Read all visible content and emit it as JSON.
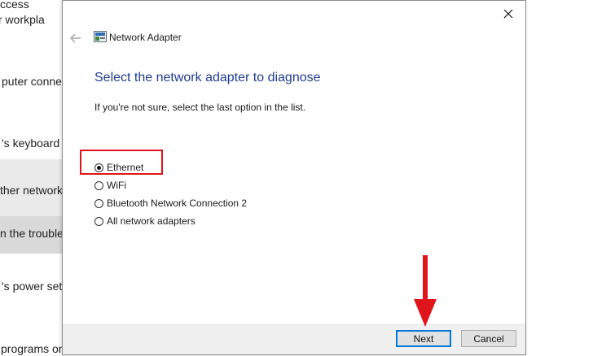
{
  "background": {
    "items": [
      "ccess",
      "r workpla",
      "puter conne",
      "'s keyboard",
      "ther network",
      "n the trouble",
      "'s power set",
      "programs on"
    ]
  },
  "dialog": {
    "app_title": "Network Adapter",
    "heading": "Select the network adapter to diagnose",
    "subtext": "If you're not sure, select the last option in the list.",
    "options": [
      {
        "label": "Ethernet",
        "checked": true
      },
      {
        "label": "WiFi",
        "checked": false
      },
      {
        "label": "Bluetooth Network Connection 2",
        "checked": false
      },
      {
        "label": "All network adapters",
        "checked": false
      }
    ],
    "buttons": {
      "next": "Next",
      "cancel": "Cancel"
    }
  },
  "icons": [
    "back-arrow-icon",
    "network-adapter-icon",
    "close-icon",
    "annotation-arrow-icon"
  ],
  "colors": {
    "heading": "#1f3c92",
    "annotation": "#e0141b",
    "default_button_border": "#0078d7"
  }
}
